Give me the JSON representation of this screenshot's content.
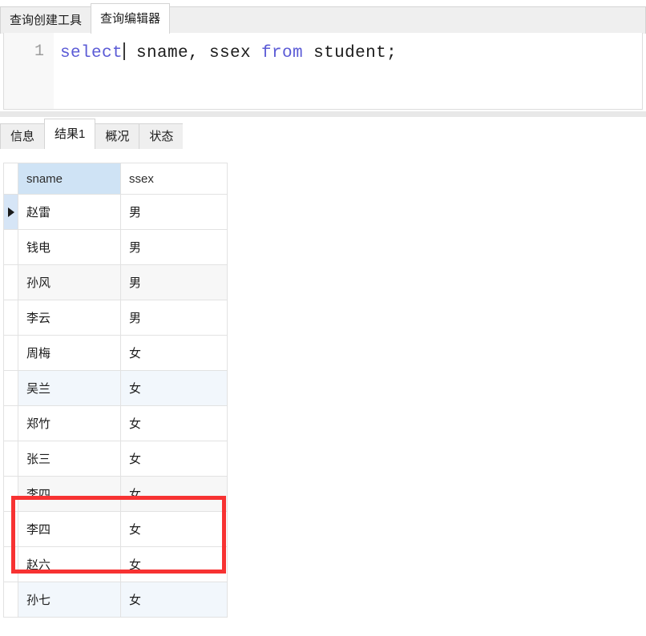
{
  "editor_tabs": [
    {
      "label": "查询创建工具",
      "active": false
    },
    {
      "label": "查询编辑器",
      "active": true
    }
  ],
  "editor": {
    "line_number": "1",
    "code_keyword_1": "select",
    "code_middle": " sname, ssex ",
    "code_keyword_2": "from",
    "code_tail": " student;",
    "full_query": "select sname, ssex from student;",
    "keyword_color": "#5b5bd6",
    "caret_after": "select"
  },
  "result_tabs": [
    {
      "label": "信息",
      "active": false
    },
    {
      "label": "结果1",
      "active": true
    },
    {
      "label": "概况",
      "active": false
    },
    {
      "label": "状态",
      "active": false
    }
  ],
  "grid": {
    "columns": [
      {
        "label": "sname",
        "highlighted": true
      },
      {
        "label": "ssex",
        "highlighted": false
      }
    ],
    "current_row_indicator": "row-pointer-triangle",
    "rows": [
      {
        "sname": "赵雷",
        "ssex": "男",
        "stripe": "none",
        "current": true
      },
      {
        "sname": "钱电",
        "ssex": "男",
        "stripe": "none",
        "current": false
      },
      {
        "sname": "孙风",
        "ssex": "男",
        "stripe": "alt-gray",
        "current": false
      },
      {
        "sname": "李云",
        "ssex": "男",
        "stripe": "none",
        "current": false
      },
      {
        "sname": "周梅",
        "ssex": "女",
        "stripe": "none",
        "current": false
      },
      {
        "sname": "吴兰",
        "ssex": "女",
        "stripe": "alt-blue",
        "current": false
      },
      {
        "sname": "郑竹",
        "ssex": "女",
        "stripe": "none",
        "current": false
      },
      {
        "sname": "张三",
        "ssex": "女",
        "stripe": "none",
        "current": false
      },
      {
        "sname": "李四",
        "ssex": "女",
        "stripe": "alt-gray",
        "current": false
      },
      {
        "sname": "李四",
        "ssex": "女",
        "stripe": "none",
        "current": false
      },
      {
        "sname": "赵六",
        "ssex": "女",
        "stripe": "none",
        "current": false
      },
      {
        "sname": "孙七",
        "ssex": "女",
        "stripe": "alt-blue",
        "current": false
      }
    ]
  },
  "annotation": {
    "type": "highlight-rectangle",
    "color": "#f73232",
    "targets": [
      "李四",
      "李四"
    ]
  }
}
